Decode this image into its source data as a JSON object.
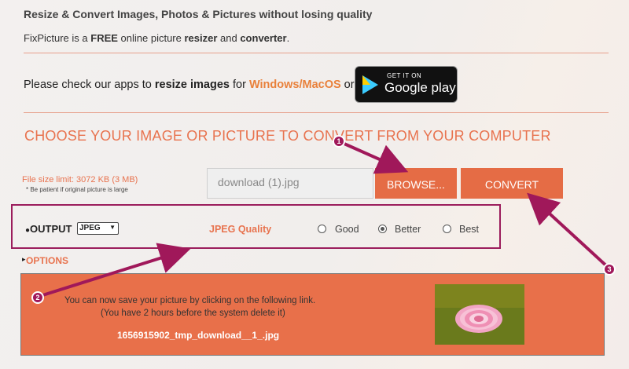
{
  "header": {
    "title": "Resize & Convert Images, Photos & Pictures without losing quality",
    "subtitle_parts": [
      "FixPicture is a ",
      "FREE",
      " online picture ",
      "resizer",
      " and ",
      "converter",
      "."
    ]
  },
  "apps": {
    "text_parts": [
      "Please check our apps to ",
      "resize images",
      " for ",
      "Windows/MacOS",
      " or"
    ],
    "google_play_small": "GET IT ON",
    "google_play_big": "Google play"
  },
  "upload": {
    "heading": "CHOOSE YOUR IMAGE OR PICTURE TO CONVERT FROM YOUR COMPUTER",
    "size_limit": "File size limit: 3072 KB (3 MB)",
    "patience_note": "* Be patient if original picture is large",
    "file_value": "download (1).jpg",
    "browse_label": "BROWSE...",
    "convert_label": "CONVERT"
  },
  "output": {
    "label": "OUTPUT",
    "format": "JPEG",
    "quality_label": "JPEG Quality",
    "qualities": [
      "Good",
      "Better",
      "Best"
    ],
    "selected_quality": "Better"
  },
  "options_label": "OPTIONS",
  "result": {
    "line1": "You can now save your picture by clicking on the following link.",
    "line2": "(You have 2 hours before the system delete it)",
    "filename": "1656915902_tmp_download__1_.jpg"
  },
  "markers": [
    "1",
    "2",
    "3"
  ],
  "colors": {
    "accent": "#e56c45",
    "link_orange": "#e9803a",
    "annotation": "#a0185a"
  },
  "icons": {
    "google_play": "google-play-logo",
    "select": "chevron-down-icon",
    "options": "triangle-right-icon"
  }
}
